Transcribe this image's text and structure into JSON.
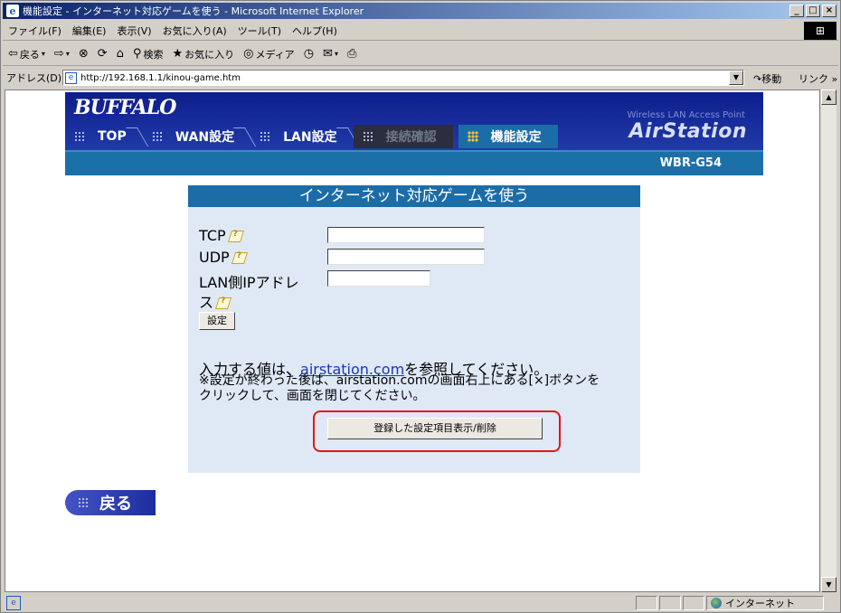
{
  "window": {
    "title": "機能設定 - インターネット対応ゲームを使う - Microsoft Internet Explorer",
    "controls": [
      "_",
      "□",
      "×"
    ]
  },
  "menu": {
    "items": [
      "ファイル(F)",
      "編集(E)",
      "表示(V)",
      "お気に入り(A)",
      "ツール(T)",
      "ヘルプ(H)"
    ]
  },
  "toolbar": {
    "back_label": "戻る",
    "search_label": "検索",
    "favorites_label": "お気に入り",
    "media_label": "メディア"
  },
  "address": {
    "label": "アドレス(D)",
    "url": "http://192.168.1.1/kinou-game.htm",
    "go_label": "移動",
    "links_label": "リンク »"
  },
  "header": {
    "logo": "BUFFALO",
    "tagline": "Wireless LAN Access Point",
    "product": "AirStation",
    "model": "WBR-G54",
    "tabs": [
      {
        "label": "TOP",
        "state": "normal"
      },
      {
        "label": "WAN設定",
        "state": "normal"
      },
      {
        "label": "LAN設定",
        "state": "normal"
      },
      {
        "label": "接続確認",
        "state": "disabled"
      },
      {
        "label": "機能設定",
        "state": "active"
      }
    ]
  },
  "panel": {
    "title": "インターネット対応ゲームを使う",
    "fields": {
      "tcp_label": "TCP",
      "tcp_value": "",
      "udp_label": "UDP",
      "udp_value": "",
      "lan_ip_label_line1": "LAN側IPアドレ",
      "lan_ip_label_line2": "ス",
      "lan_ip_value": ""
    },
    "set_button": "設定",
    "info_prefix": "入力する値は、",
    "info_link": "airstation.com",
    "info_suffix": "を参照してください。",
    "note_line1": "※設定が終わった後は、airstation.comの画面右上にある[×]ボタンを",
    "note_line2": "クリックして、画面を閉じてください。",
    "list_button": "登録した設定項目表示/削除"
  },
  "back_button": "戻る",
  "status": {
    "zone": "インターネット"
  },
  "colors": {
    "header_dark": "#0d1e8c",
    "tab_active": "#1b6da8",
    "panel_bg": "#dfe9f5",
    "highlight": "#e2141d"
  }
}
